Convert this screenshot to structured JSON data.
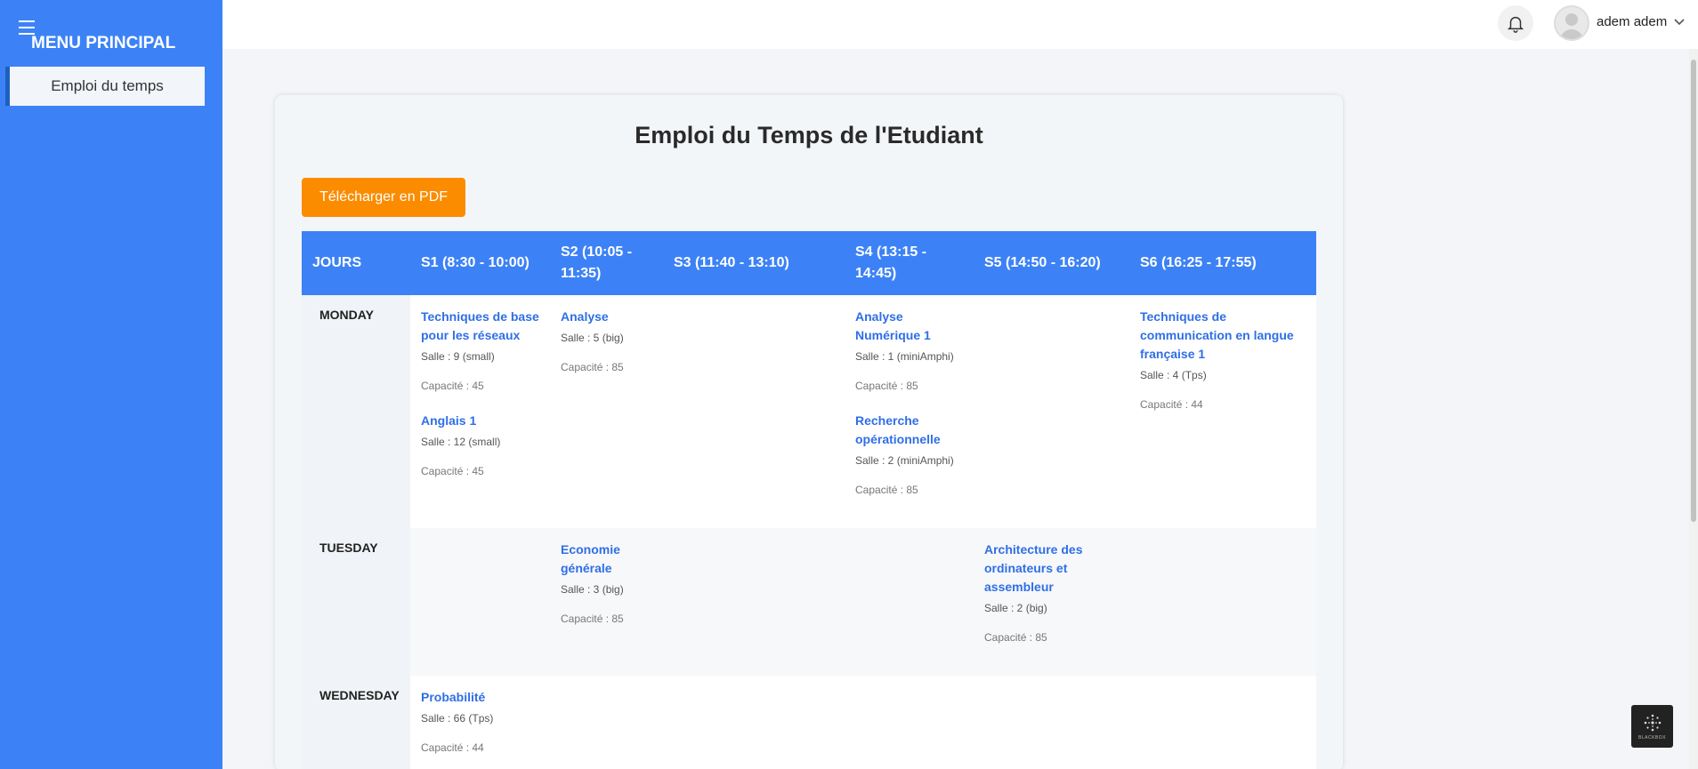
{
  "sidebar": {
    "title": "MENU PRINCIPAL",
    "items": [
      {
        "label": "Emploi du temps"
      }
    ]
  },
  "topbar": {
    "user_name": "adem adem"
  },
  "main": {
    "title": "Emploi du Temps de l'Etudiant",
    "pdf_button": "Télécharger en PDF",
    "table": {
      "headers": [
        "JOURS",
        "S1 (8:30 - 10:00)",
        "S2 (10:05 - 11:35)",
        "S3 (11:40 - 13:10)",
        "S4 (13:15 - 14:45)",
        "S5 (14:50 - 16:20)",
        "S6 (16:25 - 17:55)"
      ],
      "rows": [
        {
          "day": "MONDAY",
          "cells": [
            [
              {
                "name": "Techniques de base pour les réseaux",
                "salle": "Salle : 9 (small)",
                "capacite": "Capacité : 45"
              },
              {
                "name": "Anglais 1",
                "salle": "Salle : 12 (small)",
                "capacite": "Capacité : 45"
              }
            ],
            [
              {
                "name": "Analyse",
                "salle": "Salle : 5 (big)",
                "capacite": "Capacité : 85"
              }
            ],
            [],
            [
              {
                "name": "Analyse Numérique 1",
                "salle": "Salle : 1 (miniAmphi)",
                "capacite": "Capacité : 85"
              },
              {
                "name": "Recherche opérationnelle",
                "salle": "Salle : 2 (miniAmphi)",
                "capacite": "Capacité : 85"
              }
            ],
            [],
            [
              {
                "name": "Techniques de communication en langue française 1",
                "salle": "Salle : 4 (Tps)",
                "capacite": "Capacité : 44"
              }
            ]
          ]
        },
        {
          "day": "TUESDAY",
          "cells": [
            [],
            [
              {
                "name": "Economie générale",
                "salle": "Salle : 3 (big)",
                "capacite": "Capacité : 85"
              }
            ],
            [],
            [],
            [
              {
                "name": "Architecture des ordinateurs et assembleur",
                "salle": "Salle : 2 (big)",
                "capacite": "Capacité : 85"
              }
            ],
            []
          ]
        },
        {
          "day": "WEDNESDAY",
          "cells": [
            [
              {
                "name": "Probabilité",
                "salle": "Salle : 66 (Tps)",
                "capacite": "Capacité : 44"
              }
            ],
            [],
            [],
            [],
            [],
            []
          ]
        }
      ]
    }
  },
  "badge": {
    "label": "BLACKBOX"
  },
  "colors": {
    "sidebar": "#3c82f6",
    "header": "#3c82f6",
    "pdf_button": "#fb8c00",
    "course_link": "#2f6fe6"
  },
  "icons": [
    "menu-icon",
    "bell-icon",
    "user-avatar-icon",
    "chevron-down-icon"
  ]
}
